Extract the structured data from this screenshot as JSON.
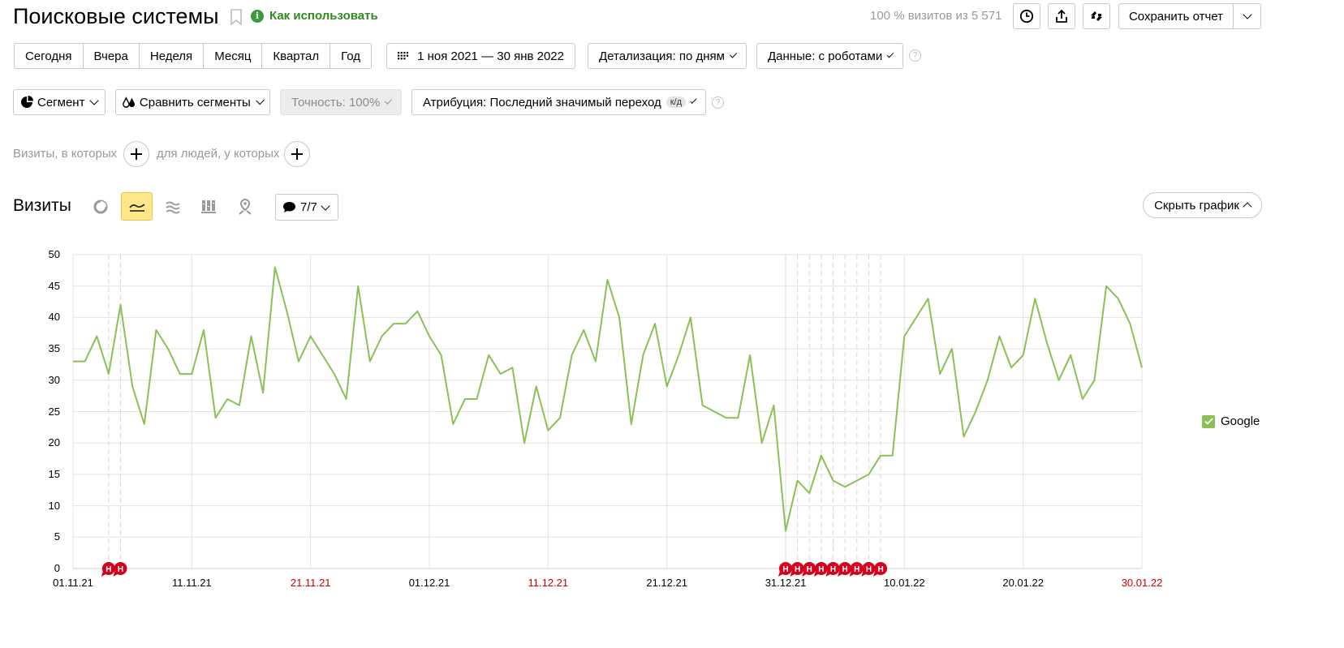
{
  "header": {
    "title": "Поисковые системы",
    "how_to_use": "Как использовать",
    "visits_info": "100 % визитов из 5 571",
    "save_report": "Сохранить отчет"
  },
  "periods": [
    "Сегодня",
    "Вчера",
    "Неделя",
    "Месяц",
    "Квартал",
    "Год"
  ],
  "date_range": "1 ноя 2021 — 30 янв 2022",
  "detail": "Детализация: по дням",
  "data_mode": "Данные: с роботами",
  "segment": "Сегмент",
  "compare_segments": "Сравнить сегменты",
  "accuracy": "Точность: 100%",
  "attribution": "Атрибуция: Последний значимый переход",
  "attribution_badge": "к/д",
  "filters": {
    "visits_label": "Визиты, в которых",
    "people_label": "для людей, у которых"
  },
  "chart_header": {
    "title": "Визиты",
    "annotations": "7/7",
    "hide_chart": "Скрыть график"
  },
  "legend": {
    "google": "Google"
  },
  "colors": {
    "series": "#8ac157",
    "accent": "#ffe78a",
    "holiday": "#cc0000",
    "marker": "#d6001c",
    "green": "#3b9b3b"
  },
  "chart_data": {
    "type": "line",
    "title": "",
    "x_ticks": [
      {
        "label": "01.11.21",
        "index": 0,
        "holiday": false
      },
      {
        "label": "11.11.21",
        "index": 10,
        "holiday": false
      },
      {
        "label": "21.11.21",
        "index": 20,
        "holiday": true
      },
      {
        "label": "01.12.21",
        "index": 30,
        "holiday": false
      },
      {
        "label": "11.12.21",
        "index": 40,
        "holiday": true
      },
      {
        "label": "21.12.21",
        "index": 50,
        "holiday": false
      },
      {
        "label": "31.12.21",
        "index": 60,
        "holiday": false
      },
      {
        "label": "10.01.22",
        "index": 70,
        "holiday": false
      },
      {
        "label": "20.01.22",
        "index": 80,
        "holiday": false
      },
      {
        "label": "30.01.22",
        "index": 90,
        "holiday": true
      }
    ],
    "y_ticks": [
      0,
      5,
      10,
      15,
      20,
      25,
      30,
      35,
      40,
      45,
      50
    ],
    "ylim": [
      0,
      50
    ],
    "grid": true,
    "series": [
      {
        "name": "Google",
        "values": [
          33,
          33,
          37,
          31,
          42,
          29,
          23,
          38,
          35,
          31,
          31,
          38,
          24,
          27,
          26,
          37,
          28,
          48,
          41,
          33,
          37,
          34,
          31,
          27,
          45,
          33,
          37,
          39,
          39,
          41,
          37,
          34,
          23,
          27,
          27,
          34,
          31,
          32,
          20,
          29,
          22,
          24,
          34,
          38,
          33,
          46,
          40,
          23,
          34,
          39,
          29,
          34,
          40,
          26,
          25,
          24,
          24,
          34,
          20,
          26,
          6,
          14,
          12,
          18,
          14,
          13,
          14,
          15,
          18,
          18,
          37,
          40,
          43,
          31,
          35,
          21,
          25,
          30,
          37,
          32,
          34,
          43,
          36,
          30,
          34,
          27,
          30,
          45,
          43,
          39,
          32
        ]
      }
    ],
    "holiday_marker_label": "Н",
    "holiday_markers": [
      3,
      4,
      60,
      61,
      62,
      63,
      64,
      65,
      66,
      67,
      68
    ]
  }
}
